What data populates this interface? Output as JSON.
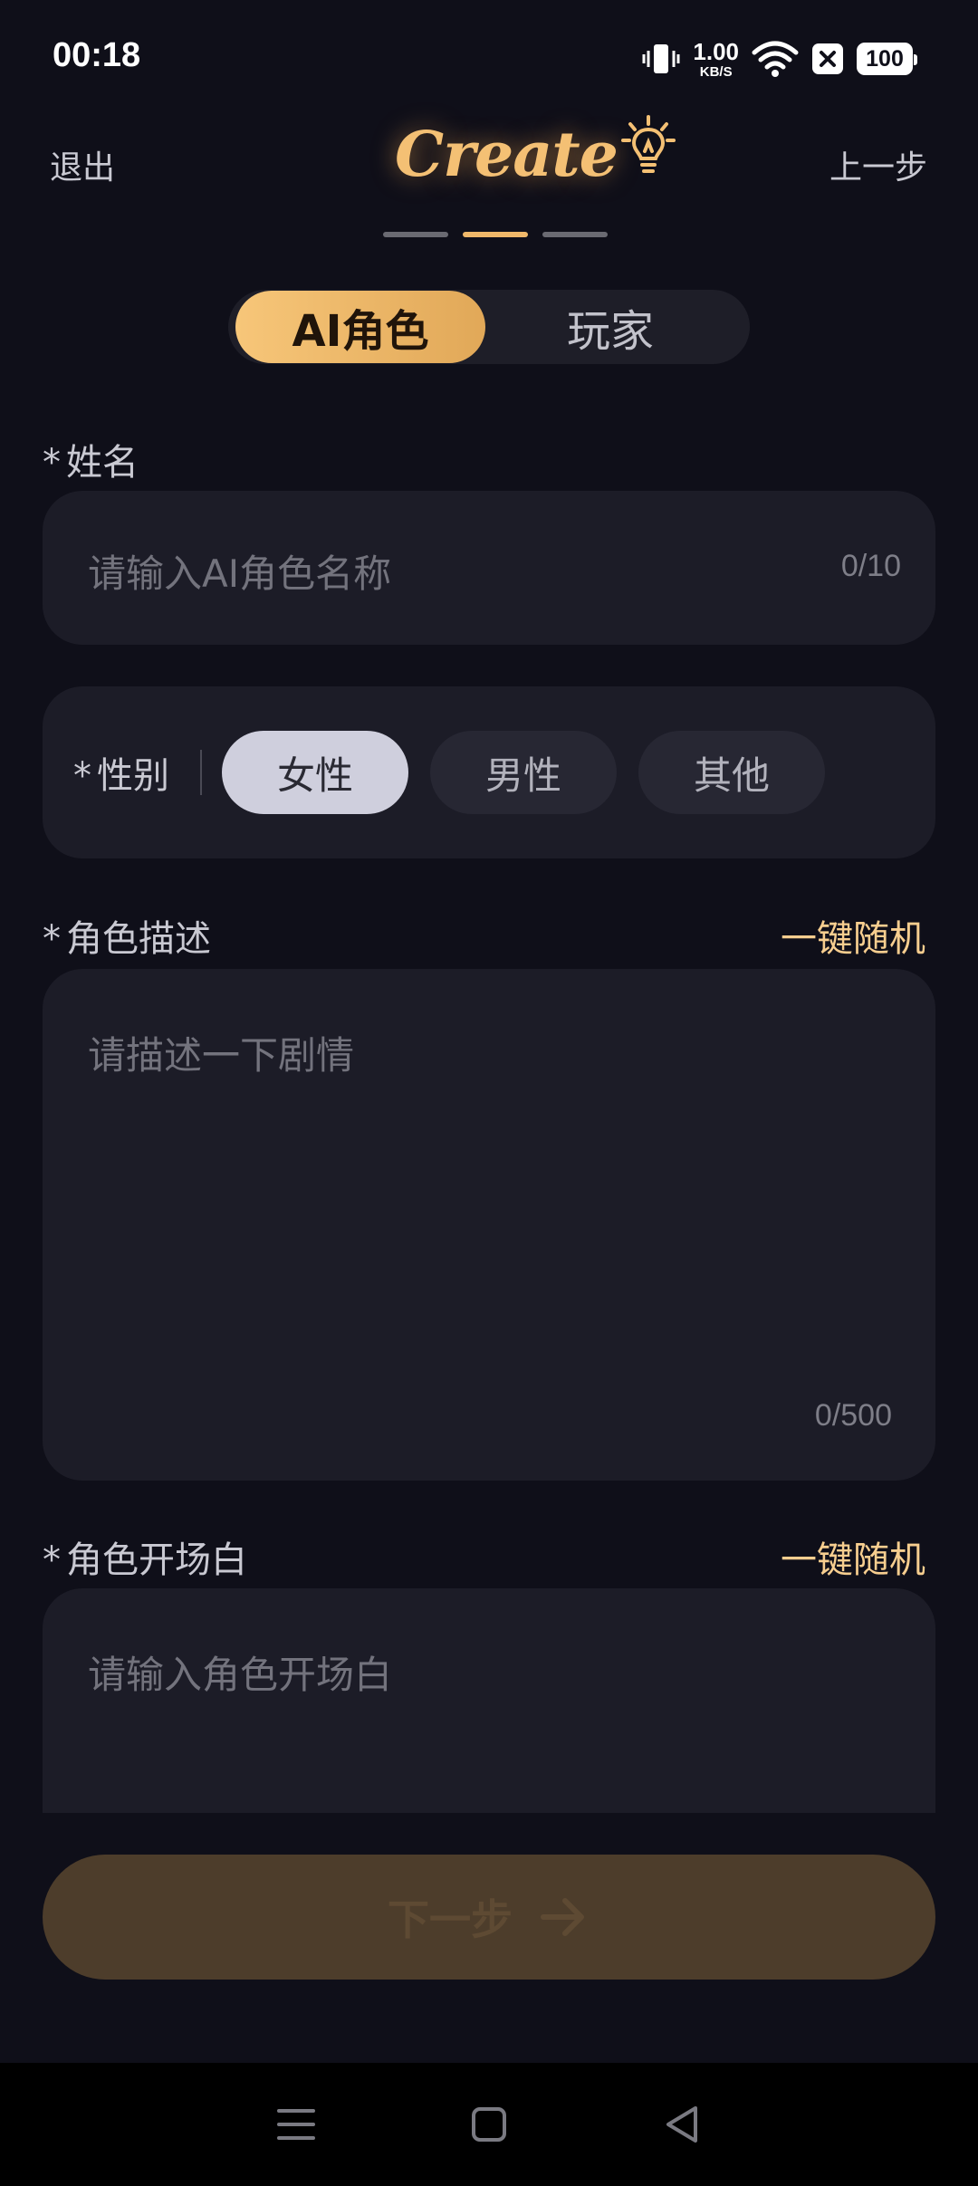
{
  "status_bar": {
    "time": "00:18",
    "net_speed_value": "1.00",
    "net_speed_unit": "KB/S",
    "battery": "100",
    "icons": [
      "vibrate-icon",
      "wifi-icon",
      "close-box-icon",
      "battery-icon"
    ]
  },
  "header": {
    "exit_label": "退出",
    "logo_text": "Create",
    "back_label": "上一步",
    "steps_total": 3,
    "steps_active_index": 1
  },
  "segment": {
    "options": [
      "AI角色",
      "玩家"
    ],
    "selected": "AI角色"
  },
  "form": {
    "name": {
      "label": "姓名",
      "required_mark": "*",
      "placeholder": "请输入AI角色名称",
      "value": "",
      "counter": "0/10"
    },
    "gender": {
      "label": "性别",
      "required_mark": "*",
      "options": [
        "女性",
        "男性",
        "其他"
      ],
      "selected": "女性"
    },
    "description": {
      "label": "角色描述",
      "required_mark": "*",
      "random_label": "一键随机",
      "placeholder": "请描述一下剧情",
      "value": "",
      "counter": "0/500"
    },
    "opening": {
      "label": "角色开场白",
      "required_mark": "*",
      "random_label": "一键随机",
      "placeholder": "请输入角色开场白",
      "value": ""
    }
  },
  "next_button": {
    "label": "下一步"
  },
  "colors": {
    "background": "#0f0f19",
    "card": "#1c1c27",
    "accent": "#f0b86a",
    "random_link": "#f7ce8f",
    "next_button_bg": "#4d3d2b"
  },
  "nav_bar": {
    "icons": [
      "menu-icon",
      "home-square-icon",
      "back-triangle-icon"
    ]
  }
}
